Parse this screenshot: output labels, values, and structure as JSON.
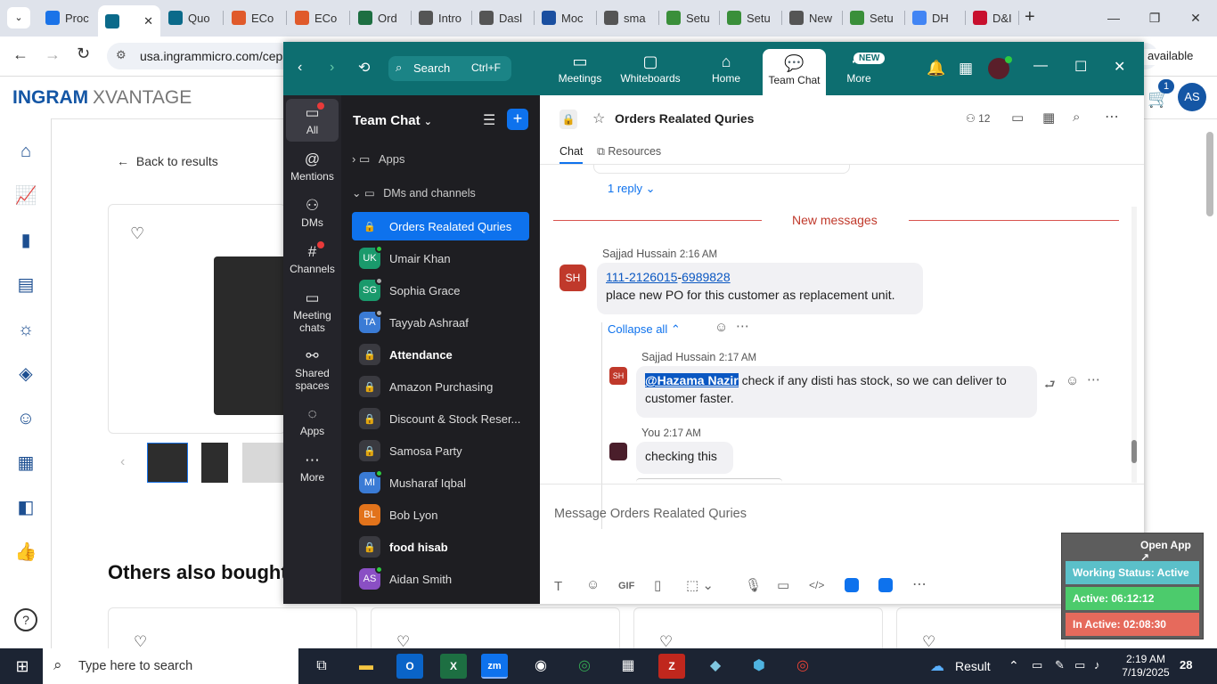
{
  "browser": {
    "tabs": [
      {
        "label": "Proc",
        "icon": "ec-icon",
        "color": "#1a73e8"
      },
      {
        "label": "",
        "icon": "sharepoint-icon",
        "color": "#0b6a8a",
        "active": true
      },
      {
        "label": "Quo",
        "icon": "sharepoint-icon",
        "color": "#0b6a8a"
      },
      {
        "label": "ECo",
        "icon": "s-icon",
        "color": "#e05a2b"
      },
      {
        "label": "ECo",
        "icon": "s-icon",
        "color": "#e05a2b"
      },
      {
        "label": "Ord",
        "icon": "excel-icon",
        "color": "#1d6f42"
      },
      {
        "label": "Intro",
        "icon": "globe-icon",
        "color": "#555"
      },
      {
        "label": "Dasl",
        "icon": "globe-icon",
        "color": "#555"
      },
      {
        "label": "Moc",
        "icon": "etn-icon",
        "color": "#1a4fa0"
      },
      {
        "label": "sma",
        "icon": "globe-icon",
        "color": "#555"
      },
      {
        "label": "Setu",
        "icon": "molecule-icon",
        "color": "#3a8f3a"
      },
      {
        "label": "Setu",
        "icon": "molecule-icon",
        "color": "#3a8f3a"
      },
      {
        "label": "New",
        "icon": "globe-icon",
        "color": "#555"
      },
      {
        "label": "Setu",
        "icon": "molecule-icon",
        "color": "#3a8f3a"
      },
      {
        "label": "DH",
        "icon": "google-icon",
        "color": "#4285f4"
      },
      {
        "label": "D&I",
        "icon": "dni-icon",
        "color": "#c8102e"
      }
    ],
    "url": "usa.ingrammicro.com/cep",
    "available_text": "available"
  },
  "page": {
    "logo_main": "INGRAM",
    "logo_sub": "XVANTAGE",
    "back_label": "Back to results",
    "others_heading": "Others also bought",
    "cart_count": "1",
    "user_initials": "AS"
  },
  "zoom": {
    "search_label": "Search",
    "search_shortcut": "Ctrl+F",
    "nav": [
      {
        "label": "Meetings"
      },
      {
        "label": "Whiteboards"
      },
      {
        "label": "Home"
      },
      {
        "label": "Team Chat"
      },
      {
        "label": "More"
      }
    ],
    "new_badge": "NEW",
    "rail": [
      {
        "label": "All"
      },
      {
        "label": "Mentions"
      },
      {
        "label": "DMs"
      },
      {
        "label": "Channels"
      },
      {
        "label": "Meeting chats"
      },
      {
        "label": "Shared spaces"
      },
      {
        "label": "Apps"
      },
      {
        "label": "More"
      }
    ],
    "side_title": "Team Chat",
    "apps_label": "Apps",
    "dms_label": "DMs and channels",
    "channels": [
      {
        "label": "Orders Realated Quries",
        "kind": "lock",
        "selected": true
      },
      {
        "label": "Umair Khan",
        "kind": "av",
        "initials": "UK",
        "color": "#1a9a6c",
        "dot": "#2ecc40"
      },
      {
        "label": "Sophia Grace",
        "kind": "av",
        "initials": "SG",
        "color": "#1a9a6c",
        "dot": "#aaaaaa"
      },
      {
        "label": "Tayyab Ashraaf",
        "kind": "av",
        "initials": "TA",
        "color": "#3a7bd5",
        "dot": "#aaaaaa"
      },
      {
        "label": "Attendance",
        "kind": "lock",
        "bold": true
      },
      {
        "label": "Amazon Purchasing",
        "kind": "lock"
      },
      {
        "label": "Discount & Stock Reser...",
        "kind": "lock"
      },
      {
        "label": "Samosa Party",
        "kind": "lock"
      },
      {
        "label": "Musharaf Iqbal",
        "kind": "av",
        "initials": "MI",
        "color": "#3a7bd5",
        "dot": "#2ecc40"
      },
      {
        "label": "Bob Lyon",
        "kind": "av",
        "initials": "BL",
        "color": "#e2731b",
        "dot": ""
      },
      {
        "label": "food hisab",
        "kind": "lock",
        "bold": true
      },
      {
        "label": "Aidan Smith",
        "kind": "av",
        "initials": "AS",
        "color": "#8a4fc4",
        "dot": "#2ecc40"
      }
    ],
    "chat_title": "Orders Realated Quries",
    "member_count": "12",
    "tab_chat": "Chat",
    "tab_resources": "Resources",
    "reply_label": "1 reply",
    "new_messages": "New messages",
    "msg1": {
      "initials": "SH",
      "author": "Sajjad Hussain",
      "time": "2:16 AM",
      "line1_a": "111-2126015",
      "line1_b": "-",
      "line1_c": "6989828",
      "line2": "place new PO for this customer as replacement unit."
    },
    "collapse_label": "Collapse all",
    "msg2": {
      "initials": "SH",
      "author": "Sajjad Hussain",
      "time": "2:17 AM",
      "mention": "@Hazama Nazir",
      "text1": " check if any disti has stock, so we can deliver to",
      "text2": "customer faster."
    },
    "msg3": {
      "author": "You",
      "time": "2:17 AM",
      "text": "checking this"
    },
    "composer_placeholder": "Message Orders Realated Quries"
  },
  "status_widget": {
    "open_app": "Open App ↗",
    "working": "Working Status: Active",
    "active": "Active: 06:12:12",
    "inactive": "In Active: 02:08:30"
  },
  "taskbar": {
    "search_placeholder": "Type here to search",
    "result_label": "Result",
    "time": "2:19 AM",
    "date": "7/19/2025",
    "notif_count": "28"
  }
}
